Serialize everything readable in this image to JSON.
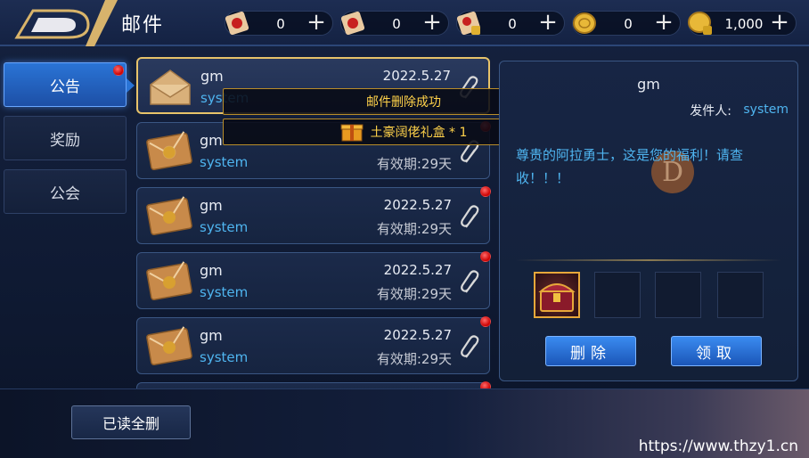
{
  "header": {
    "title": "邮件",
    "resources": [
      {
        "icon": "red-scroll-icon",
        "value": "0"
      },
      {
        "icon": "red-scroll-icon",
        "value": "0"
      },
      {
        "icon": "locked-scroll-icon",
        "value": "0"
      },
      {
        "icon": "gold-coin-icon",
        "value": "0"
      },
      {
        "icon": "locked-gold-coin-icon",
        "value": "1,000"
      }
    ],
    "plus": "+"
  },
  "tabs": [
    {
      "label": "公告",
      "active": true,
      "badge": true
    },
    {
      "label": "奖励",
      "active": false,
      "badge": false
    },
    {
      "label": "公会",
      "active": false,
      "badge": false
    }
  ],
  "mails": [
    {
      "sender": "gm",
      "from": "system",
      "date": "2022.5.27",
      "expiry": "",
      "opened": true,
      "selected": true,
      "badge": false
    },
    {
      "sender": "gm",
      "from": "system",
      "date": "",
      "expiry": "有效期:29天",
      "opened": false,
      "selected": false,
      "badge": true
    },
    {
      "sender": "gm",
      "from": "system",
      "date": "2022.5.27",
      "expiry": "有效期:29天",
      "opened": false,
      "selected": false,
      "badge": true
    },
    {
      "sender": "gm",
      "from": "system",
      "date": "2022.5.27",
      "expiry": "有效期:29天",
      "opened": false,
      "selected": false,
      "badge": true
    },
    {
      "sender": "gm",
      "from": "system",
      "date": "2022.5.27",
      "expiry": "有效期:29天",
      "opened": false,
      "selected": false,
      "badge": true
    }
  ],
  "toasts": {
    "deleted": "邮件删除成功",
    "reward": "土豪阔佬礼盒 * 1"
  },
  "detail": {
    "title": "gm",
    "sender_label": "发件人:",
    "sender": "system",
    "body": "尊贵的阿拉勇士，这是您的福利！请查收！！！",
    "watermark": "D",
    "delete_label": "删除",
    "claim_label": "领取"
  },
  "footer": {
    "read_delete_label": "已读全删",
    "url": "https://www.thzy1.cn"
  },
  "colors": {
    "accent_blue": "#4fb5f0",
    "gold": "#ffd24a",
    "badge_red": "#e02020"
  }
}
